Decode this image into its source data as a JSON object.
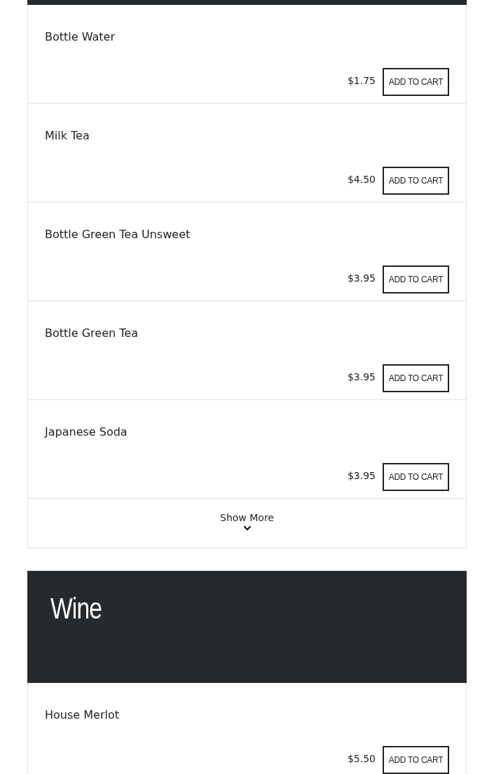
{
  "sections": [
    {
      "items": [
        {
          "name": "Bottle Water",
          "price": "$1.75",
          "button": "ADD TO CART"
        },
        {
          "name": "Milk Tea",
          "price": "$4.50",
          "button": "ADD TO CART"
        },
        {
          "name": "Bottle Green Tea Unsweet",
          "price": "$3.95",
          "button": "ADD TO CART"
        },
        {
          "name": "Bottle Green Tea",
          "price": "$3.95",
          "button": "ADD TO CART"
        },
        {
          "name": "Japanese Soda",
          "price": "$3.95",
          "button": "ADD TO CART"
        }
      ],
      "show_more": "Show More"
    },
    {
      "title": "Wine",
      "items": [
        {
          "name": "House Merlot",
          "price": "$5.50",
          "button": "ADD TO CART"
        }
      ]
    }
  ]
}
